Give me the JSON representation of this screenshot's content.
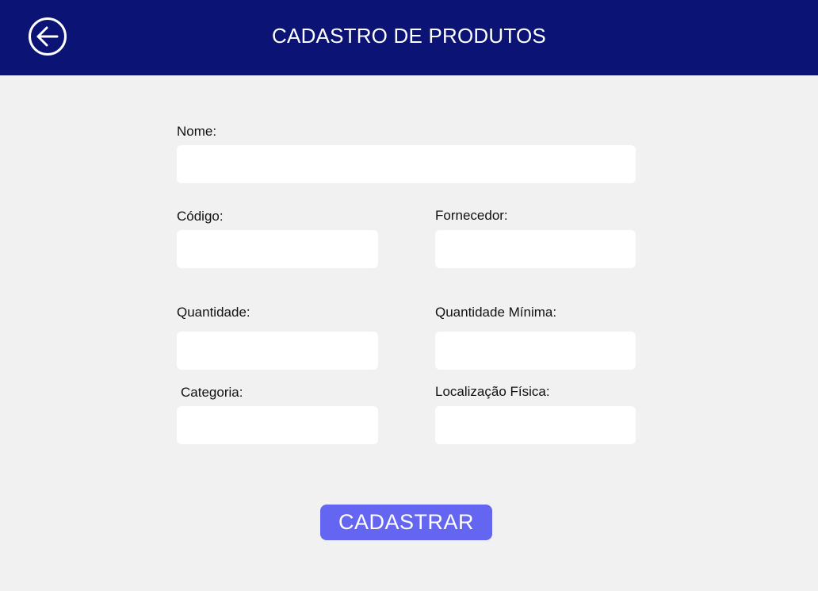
{
  "header": {
    "title": "CADASTRO DE PRODUTOS",
    "back_icon": "arrow-left-circle-icon"
  },
  "form": {
    "nome": {
      "label": "Nome:",
      "value": "",
      "placeholder": ""
    },
    "codigo": {
      "label": "Código:",
      "value": "",
      "placeholder": ""
    },
    "fornecedor": {
      "label": "Fornecedor:",
      "value": "",
      "placeholder": ""
    },
    "quantidade": {
      "label": "Quantidade:",
      "value": "",
      "placeholder": ""
    },
    "quantidade_minima": {
      "label": "Quantidade Mínima:",
      "value": "",
      "placeholder": ""
    },
    "categoria": {
      "label": "Categoria:",
      "value": "",
      "placeholder": ""
    },
    "localizacao_fisica": {
      "label": "Localização Física:",
      "value": "",
      "placeholder": ""
    },
    "submit_label": "CADASTRAR"
  },
  "colors": {
    "header_bg": "#0b1374",
    "page_bg": "#f1f1f1",
    "button_bg": "#6465f0",
    "field_bg": "#ffffff"
  }
}
